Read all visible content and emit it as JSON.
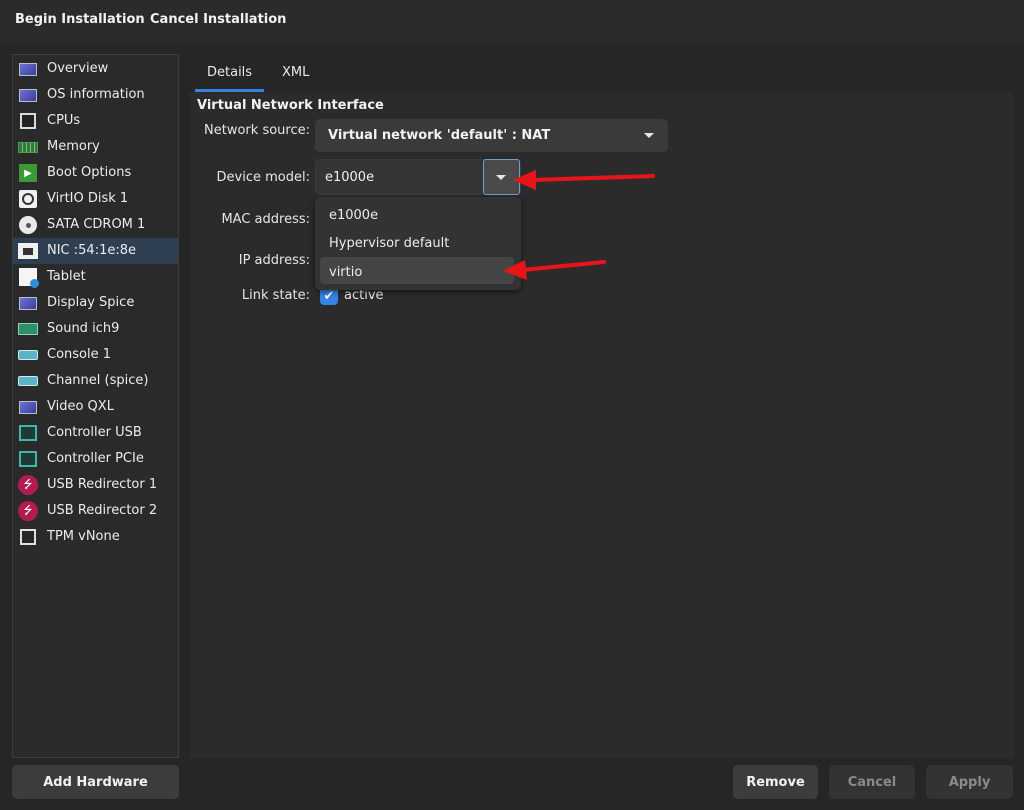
{
  "toolbar": {
    "begin_label": "Begin Installation",
    "cancel_label": "Cancel Installation"
  },
  "sidebar": {
    "items": [
      {
        "label": "Overview",
        "icon": "monitor-icon"
      },
      {
        "label": "OS information",
        "icon": "monitor-icon"
      },
      {
        "label": "CPUs",
        "icon": "cpu-icon"
      },
      {
        "label": "Memory",
        "icon": "memory-icon"
      },
      {
        "label": "Boot Options",
        "icon": "boot-icon"
      },
      {
        "label": "VirtIO Disk 1",
        "icon": "disk-icon"
      },
      {
        "label": "SATA CDROM 1",
        "icon": "cdrom-icon"
      },
      {
        "label": "NIC :54:1e:8e",
        "icon": "nic-icon",
        "selected": true
      },
      {
        "label": "Tablet",
        "icon": "tablet-icon"
      },
      {
        "label": "Display Spice",
        "icon": "display-icon"
      },
      {
        "label": "Sound ich9",
        "icon": "sound-icon"
      },
      {
        "label": "Console 1",
        "icon": "serial-icon"
      },
      {
        "label": "Channel (spice)",
        "icon": "serial-icon"
      },
      {
        "label": "Video QXL",
        "icon": "video-icon"
      },
      {
        "label": "Controller USB",
        "icon": "controller-icon"
      },
      {
        "label": "Controller PCIe",
        "icon": "controller-icon"
      },
      {
        "label": "USB Redirector 1",
        "icon": "usb-icon"
      },
      {
        "label": "USB Redirector 2",
        "icon": "usb-icon"
      },
      {
        "label": "TPM vNone",
        "icon": "tpm-icon"
      }
    ]
  },
  "tabs": [
    {
      "label": "Details",
      "active": true
    },
    {
      "label": "XML"
    }
  ],
  "details": {
    "section_title": "Virtual Network Interface",
    "network_source_label": "Network source:",
    "network_source_value": "Virtual network 'default' : NAT",
    "device_model_label": "Device model:",
    "device_model_value": "e1000e",
    "mac_label": "MAC address:",
    "ip_label": "IP address:",
    "link_state_label": "Link state:",
    "link_state_value": "active",
    "link_state_checked": true,
    "dropdown_options": [
      "e1000e",
      "Hypervisor default",
      "virtio"
    ],
    "dropdown_highlighted": "virtio"
  },
  "annotation_color": "#e8141a",
  "accent_color": "#3584e4",
  "footer": {
    "add_hardware_label": "Add Hardware",
    "remove_label": "Remove",
    "cancel_label": "Cancel",
    "apply_label": "Apply"
  }
}
